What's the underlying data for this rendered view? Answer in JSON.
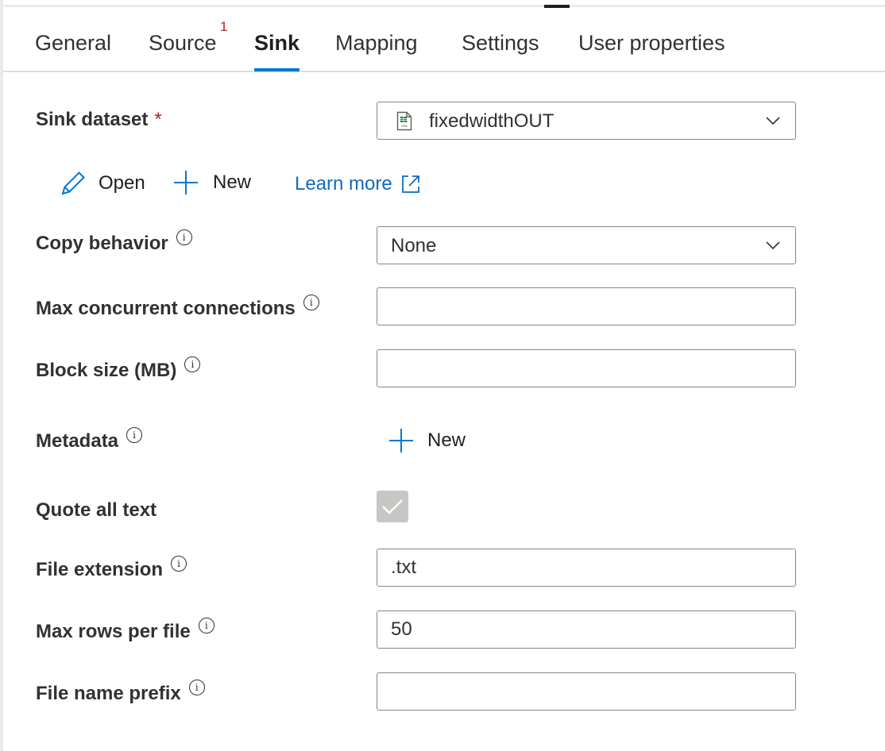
{
  "tabs": {
    "general": "General",
    "source": "Source",
    "source_badge": "1",
    "sink": "Sink",
    "mapping": "Mapping",
    "settings": "Settings",
    "user_properties": "User properties"
  },
  "sink_dataset": {
    "label": "Sink dataset",
    "required_mark": "*",
    "value": "fixedwidthOUT",
    "icon": "csv-file-icon"
  },
  "dataset_actions": {
    "open": "Open",
    "new": "New",
    "learn_more": "Learn more"
  },
  "copy_behavior": {
    "label": "Copy behavior",
    "value": "None"
  },
  "max_concurrent_connections": {
    "label": "Max concurrent connections",
    "value": ""
  },
  "block_size": {
    "label": "Block size (MB)",
    "value": ""
  },
  "metadata": {
    "label": "Metadata",
    "new_label": "New"
  },
  "quote_all_text": {
    "label": "Quote all text",
    "checked": true
  },
  "file_extension": {
    "label": "File extension",
    "value": ".txt"
  },
  "max_rows_per_file": {
    "label": "Max rows per file",
    "value": "50"
  },
  "file_name_prefix": {
    "label": "File name prefix",
    "value": ""
  },
  "colors": {
    "accent": "#0078d4",
    "link": "#0f6cbd",
    "required": "#a4262c",
    "checkbox_disabled": "#c8c6c4"
  }
}
